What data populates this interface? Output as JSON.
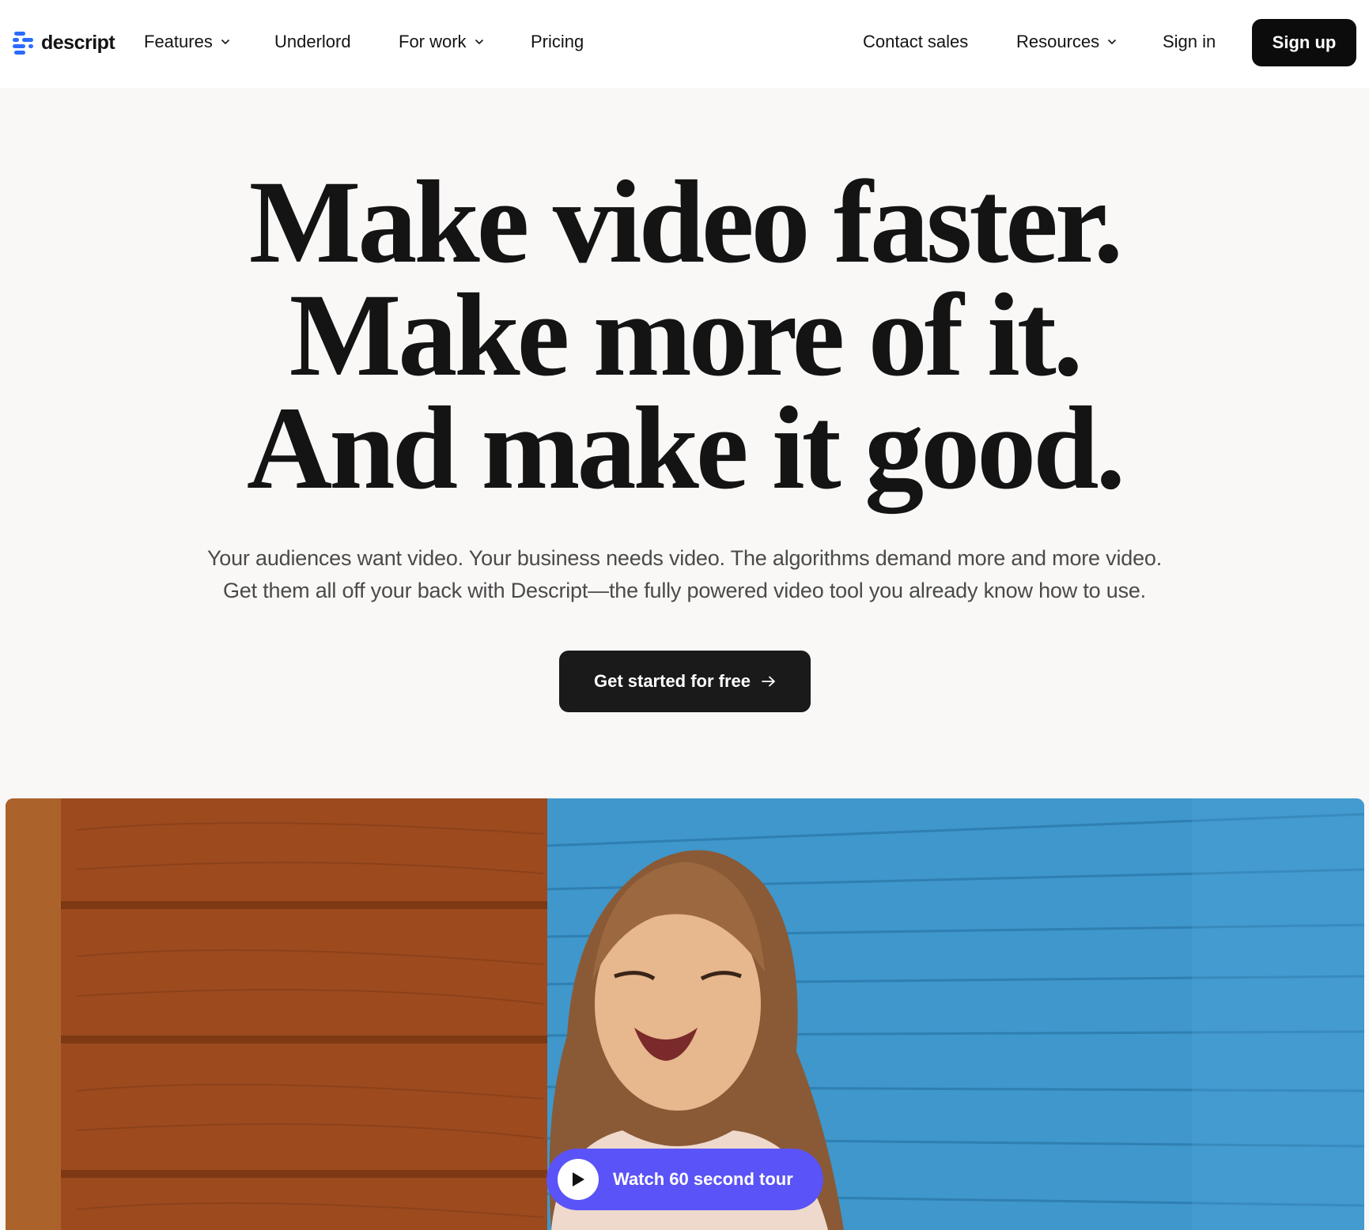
{
  "brand": {
    "name": "descript",
    "accent": "#2b6bff"
  },
  "nav": {
    "left": [
      {
        "label": "Features",
        "has_dropdown": true
      },
      {
        "label": "Underlord",
        "has_dropdown": false
      },
      {
        "label": "For work",
        "has_dropdown": true
      },
      {
        "label": "Pricing",
        "has_dropdown": false
      }
    ],
    "right": [
      {
        "label": "Contact sales",
        "has_dropdown": false
      },
      {
        "label": "Resources",
        "has_dropdown": true
      },
      {
        "label": "Sign in",
        "has_dropdown": false
      }
    ],
    "signup_label": "Sign up"
  },
  "hero": {
    "headline": [
      "Make video faster.",
      "Make more of it.",
      "And make it good."
    ],
    "subtext": [
      "Your audiences want video. Your business needs video. The algorithms demand more and more video.",
      "Get them all off your back with Descript—the fully powered video tool you already know how to use."
    ],
    "cta_label": "Get started for free"
  },
  "video": {
    "tour_label": "Watch 60 second tour",
    "tour_color": "#5a53f7"
  },
  "icons": {
    "logo": "descript-logo-icon",
    "dropdown": "chevron-down-icon",
    "cta": "arrow-right-icon",
    "tour": "play-icon"
  }
}
